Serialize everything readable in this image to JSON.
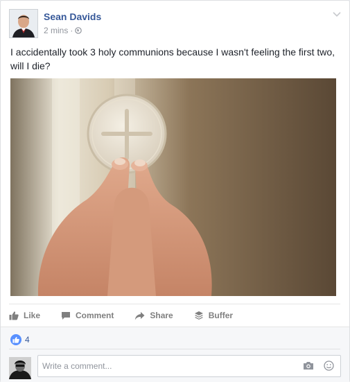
{
  "post": {
    "author": "Sean Davids",
    "timestamp": "2 mins",
    "separator": "·",
    "privacy_icon": "globe-icon",
    "text": "I accidentally took 3 holy communions because I wasn't feeling the first two, will I die?",
    "image": "hands-holding-communion-wafer"
  },
  "actions": {
    "like": "Like",
    "comment": "Comment",
    "share": "Share",
    "buffer": "Buffer"
  },
  "reactions": {
    "count": "4"
  },
  "comment": {
    "placeholder": "Write a comment..."
  },
  "colors": {
    "link_blue": "#365899",
    "like_badge": "#5890ff",
    "action_gray": "#7f7f7f",
    "footer_bg": "#f6f7f9"
  }
}
